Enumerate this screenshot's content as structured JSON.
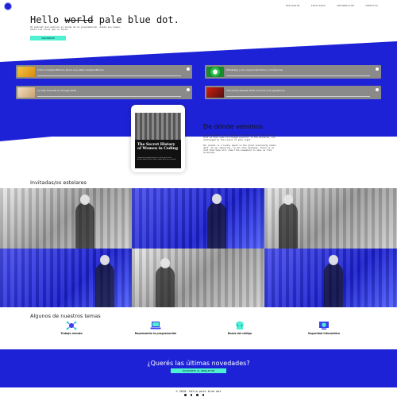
{
  "nav": [
    "EPISODIOS",
    "INVITADOS",
    "INFORMACIÓN",
    "CRÉDITOS"
  ],
  "hero": {
    "title_pre": "Hello ",
    "title_strike": "world",
    "title_post": " pale blue dot.",
    "subtitle": "Un podcast que explora el mundo de la programación, desde sus bases, hasta las voces que lo hacen.",
    "cta": "SUSCRIBITE"
  },
  "episodes": [
    "Cómo compite Bitcoins ahora que estan baratos Bitcoin",
    "Whatsapp y sus nuevos términos y condiciones",
    "La más buscada en Google 2020",
    "The Game Awards 2020: Conocé a los ganadores"
  ],
  "colors": {
    "blue": "#1e22d6",
    "accent": "#4df0d0",
    "card": "#8a8a8a"
  },
  "phone": {
    "title": "The Secret History of Women in Coding",
    "text": "Computer programming once had a much better gender balance than it does today. What went wrong?"
  },
  "origin": {
    "title": "De dónde venimos",
    "text1": "Our planet is a lonely speck in the great enveloping cosmic dark. In our obscurity, in all this vastness, there is no hint that help will come from elsewhere to save us from ourselves.",
    "text2": "Our posturings, our imagined self-importance, the delusion that we have some privileged position in the Universe, are challenged by this point of pale light."
  },
  "guests_title": "Invitadas/os estelares",
  "topics_title": "Algunos de nuestros temas",
  "topics": [
    "Trabajo remoto",
    "Repensando la programación",
    "Bases del código",
    "Seguridad informática"
  ],
  "topic_icons": [
    "network-icon",
    "laptop-icon",
    "head-code-icon",
    "shield-computer-icon"
  ],
  "newsletter": {
    "title": "¿Querés las últimas novedades?",
    "cta": "SUSCRIBITE AL NEWSLETTER"
  },
  "footer": "© 2020: Hello pale blue dot"
}
